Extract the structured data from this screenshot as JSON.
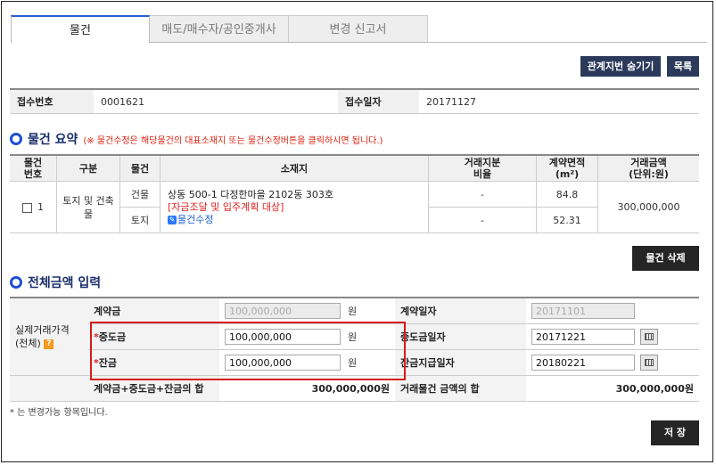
{
  "tabs": [
    {
      "label": "물건",
      "active": true
    },
    {
      "label": "매도/매수자/공인중개사",
      "active": false
    },
    {
      "label": "변경 신고서",
      "active": false
    }
  ],
  "toolbar": {
    "hide_lot_label": "관계지번 숨기기",
    "list_label": "목록"
  },
  "receipt": {
    "number_label": "접수번호",
    "number_value": "0001621",
    "date_label": "접수일자",
    "date_value": "20171127"
  },
  "summary": {
    "title": "물건 요약",
    "note": "(※ 물건수정은 해당물건의 대표소재지 또는 물건수정버튼을 클릭하시면 됩니다.)",
    "headers": {
      "item_no": "물건\n번호",
      "category": "구분",
      "item": "물건",
      "location": "소재지",
      "share_ratio": "거래지분\n비율",
      "area": "계약면적\n(m²)",
      "price": "거래금액\n(단위:원)"
    },
    "row": {
      "no": "1",
      "category": "토지 및 건축물",
      "type_building": "건물",
      "type_land": "토지",
      "address": "상동 500-1 다정한마을 2102동 303호",
      "tag": "[자금조달 및 입주계획 대상]",
      "edit_link": "물건수정",
      "ratio_building": "-",
      "ratio_land": "-",
      "area_building": "84.8",
      "area_land": "52.31",
      "price": "300,000,000"
    },
    "delete_label": "물건 삭제"
  },
  "price_input": {
    "title": "전체금액 입력",
    "group_label_1": "실제거래가격",
    "group_label_2": "(전체)",
    "help_icon": "?",
    "contract_label": "계약금",
    "contract_value": "100,000,000",
    "middle_label": "중도금",
    "middle_value": "100,000,000",
    "balance_label": "잔금",
    "balance_value": "100,000,000",
    "required_mark": "*",
    "unit": "원",
    "contract_date_label": "계약일자",
    "contract_date_value": "20171101",
    "middle_date_label": "중도금일자",
    "middle_date_value": "20171221",
    "balance_date_label": "잔금지급일자",
    "balance_date_value": "20180221",
    "sum_label": "계약금+중도금+잔금의 합",
    "sum_value": "300,000,000원",
    "total_label": "거래물건 금액의 합",
    "total_value": "300,000,000원"
  },
  "footnote": "* 는 변경가능 항목입니다.",
  "save_label": "저 장"
}
